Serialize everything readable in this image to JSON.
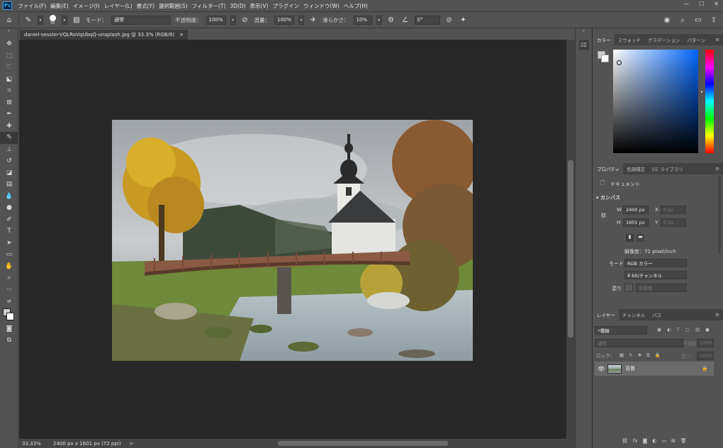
{
  "menubar": {
    "items": [
      "ファイル(F)",
      "編集(E)",
      "イメージ(I)",
      "レイヤー(L)",
      "書式(Y)",
      "選択範囲(S)",
      "フィルター(T)",
      "3D(D)",
      "表示(V)",
      "プラグイン",
      "ウィンドウ(W)",
      "ヘルプ(H)"
    ],
    "window_controls": [
      "—",
      "☐",
      "✕"
    ]
  },
  "options": {
    "brush_size": "58",
    "mode_label": "モード：",
    "mode_value": "通常",
    "opacity_label": "不透明度：",
    "opacity_value": "100%",
    "flow_label": "流量：",
    "flow_value": "100%",
    "smoothing_label": "滑らかさ：",
    "smoothing_value": "10%",
    "angle_value": "0°"
  },
  "document": {
    "tab_title": "daniel-sessler-VQLRoVqUbqQ-unsplash.jpg @ 33.3% (RGB/8)",
    "close": "×"
  },
  "status": {
    "zoom": "33.33%",
    "info": "2400 px x 1601 px (72 ppi)",
    "arrow": ">"
  },
  "color_panel": {
    "tabs": [
      "カラー",
      "スウォッチ",
      "グラデーション",
      "パターン"
    ]
  },
  "properties_panel": {
    "tabs": [
      "プロパティ",
      "色調補正",
      "CC ライブラリ"
    ],
    "doc_label": "ドキュメント",
    "section": "カンバス",
    "w_label": "W",
    "w_value": "2400 px",
    "h_label": "H",
    "h_value": "1601 px",
    "x_label": "X",
    "x_value": "0 px",
    "y_label": "Y",
    "y_value": "0 px",
    "resolution": "解像度：72 pixel/inch",
    "mode_label": "モード",
    "mode_value": "RGB カラー",
    "depth_value": "8 bit/チャンネル",
    "fill_label": "塗り",
    "fill_value": "背景色"
  },
  "layers_panel": {
    "tabs": [
      "レイヤー",
      "チャンネル",
      "パス"
    ],
    "filter_placeholder": "種類",
    "blend_mode": "通常",
    "opacity_label": "不透明度：",
    "opacity_value": "100%",
    "lock_label": "ロック：",
    "fill_label": "塗り：",
    "fill_value": "100%",
    "layer_name": "背景"
  },
  "colors": {
    "ui_bg": "#535353",
    "canvas_bg": "#282828",
    "accent": "#31a8ff"
  }
}
